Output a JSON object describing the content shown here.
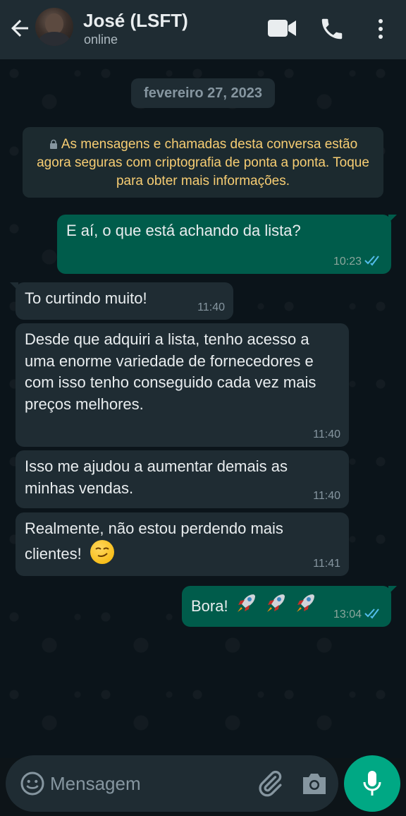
{
  "header": {
    "contact_name": "José (LSFT)",
    "status": "online"
  },
  "chat": {
    "date_chip": "fevereiro 27, 2023",
    "encryption_notice": "As mensagens e chamadas desta conversa estão agora seguras com criptografia de ponta a ponta. Toque para obter mais informações.",
    "messages": [
      {
        "direction": "out",
        "text": "E aí, o que está achando da lista?",
        "time": "10:23",
        "status": "read"
      },
      {
        "direction": "in",
        "text": "To curtindo muito!",
        "time": "11:40"
      },
      {
        "direction": "in",
        "text": "Desde que adquiri a lista, tenho acesso a uma enorme variedade de fornecedores e com isso tenho conseguido cada vez mais preços melhores.",
        "time": "11:40"
      },
      {
        "direction": "in",
        "text": "Isso me ajudou a aumentar demais as minhas vendas.",
        "time": "11:40"
      },
      {
        "direction": "in",
        "text": "Realmente, não estou perdendo mais clientes!",
        "time": "11:41",
        "emoji": "smirking-face"
      },
      {
        "direction": "out",
        "text": "Bora!",
        "time": "13:04",
        "status": "read",
        "emoji": "rocket x3"
      }
    ]
  },
  "composer": {
    "placeholder": "Mensagem"
  },
  "colors": {
    "header_bg": "#1f2c33",
    "incoming_bubble": "#1f2c33",
    "outgoing_bubble": "#005c4b",
    "accent": "#00a884",
    "read_ticks": "#53bdeb",
    "notice_text": "#f7cd73"
  }
}
